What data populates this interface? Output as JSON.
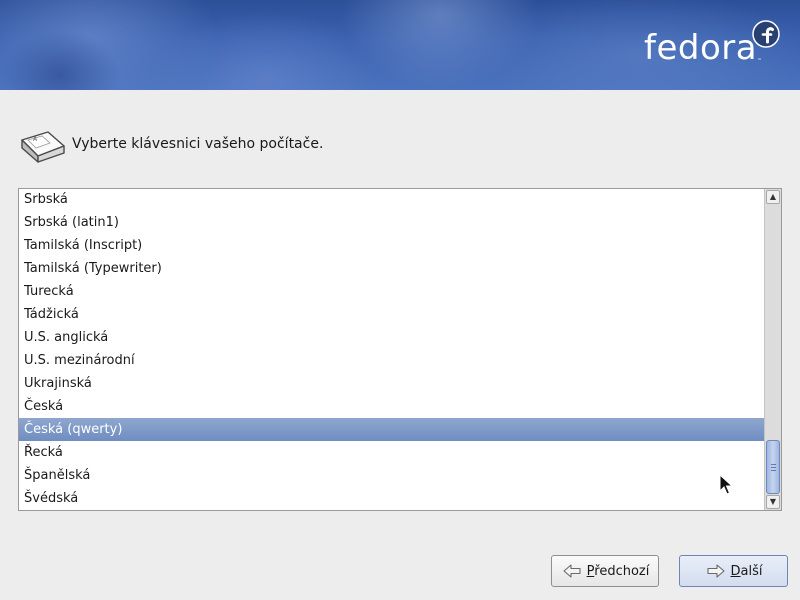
{
  "banner": {
    "logo_text": "fedora",
    "logo_trademark": "™"
  },
  "prompt": {
    "icon": "keyboard-icon",
    "text": "Vyberte klávesnici vašeho počítače."
  },
  "keyboard_list": {
    "items": [
      "Srbská",
      "Srbská (latin1)",
      "Tamilská (Inscript)",
      "Tamilská (Typewriter)",
      "Turecká",
      "Tádžická",
      "U.S. anglická",
      "U.S. mezinárodní",
      "Ukrajinská",
      "Česká",
      "Česká (qwerty)",
      "Řecká",
      "Španělská",
      "Švédská"
    ],
    "selected": "Česká (qwerty)",
    "selected_color": "#7a95c6"
  },
  "buttons": {
    "back": {
      "mnemonic": "P",
      "rest": "ředchozí",
      "icon": "back-arrow-icon"
    },
    "next": {
      "mnemonic": "D",
      "rest": "alší",
      "icon": "next-arrow-icon"
    }
  },
  "colors": {
    "banner": "#3c62b0",
    "background": "#ededed"
  }
}
